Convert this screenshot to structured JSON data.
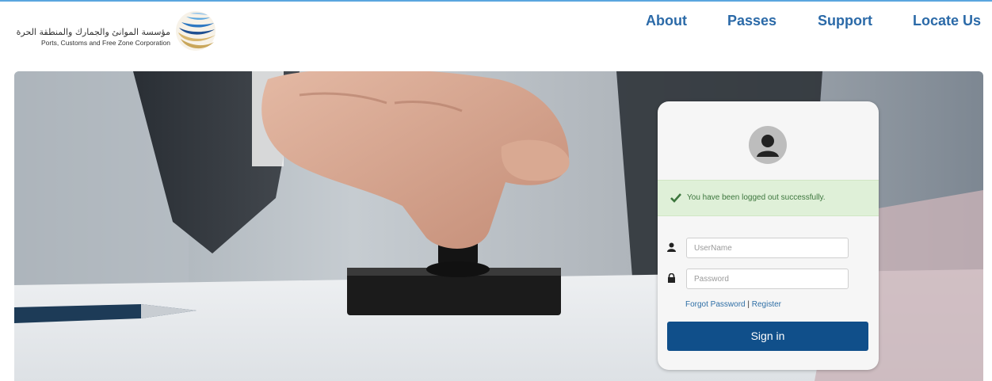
{
  "header": {
    "org_name_ar": "مؤسسة الموانئ والجمارك والمنطقة الحرة",
    "org_name_en": "Ports, Customs and Free Zone Corporation",
    "logo_icon": "globe-swirl-logo"
  },
  "nav": {
    "items": [
      {
        "label": "About"
      },
      {
        "label": "Passes"
      },
      {
        "label": "Support"
      },
      {
        "label": "Locate Us"
      }
    ],
    "color": "#2b6aa8"
  },
  "hero": {
    "image": "hand-pressing-rubber-stamp-photo"
  },
  "login": {
    "avatar_icon": "user-avatar-icon",
    "alert_text": "You have been logged out successfully.",
    "alert_icon": "checkmark-icon",
    "username_placeholder": "UserName",
    "username_icon": "user-icon",
    "password_placeholder": "Password",
    "password_icon": "lock-icon",
    "forgot_label": "Forgot Password",
    "separator": "|",
    "register_label": "Register",
    "signin_label": "Sign in",
    "signin_color": "#104f8a",
    "alert_bg": "#dff0d8"
  }
}
